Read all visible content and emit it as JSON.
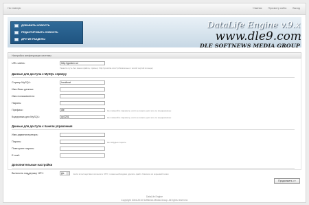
{
  "topbar": {
    "home_label": "На главную",
    "links": [
      "Главная",
      "Просмотр сайта",
      "Выход"
    ]
  },
  "header": {
    "menu": [
      {
        "label": "ДОБАВИТЬ НОВОСТЬ",
        "icon": "add-news-icon"
      },
      {
        "label": "РЕДАКТИРОВАТЬ НОВОСТЬ",
        "icon": "edit-news-icon"
      },
      {
        "label": "ДРУГИЕ РАЗДЕЛЫ",
        "icon": "sections-icon"
      }
    ],
    "logo_title": "DataLife Engine v.9.x",
    "logo_site": "www.dle9.com",
    "logo_group": "DLE SOFTNEWS MEDIA GROUP"
  },
  "panel": {
    "title": "Настройка конфигурации системы",
    "url_label": "URL сайта:",
    "url_value": "http://gordev.ru/",
    "url_hint": "Укажите путь без имени файла, пример: http://yoursite.com/ (обязательно с косой чертой в конце)",
    "db_section": "Данные для доступа к MySQL серверу",
    "db_fields": [
      {
        "label": "Сервер MySQL:",
        "value": "localhost",
        "hint": ""
      },
      {
        "label": "Имя базы данных:",
        "value": "",
        "hint": ""
      },
      {
        "label": "Имя пользователя:",
        "value": "",
        "hint": ""
      },
      {
        "label": "Пароль:",
        "value": "",
        "hint": ""
      },
      {
        "label": "Префикс:",
        "value": "dle",
        "hint": "Не изменяйте параметр, если не знаете для чего он предназначен"
      },
      {
        "label": "Кодировка для MySQL:",
        "value": "cp1251",
        "hint": "Не изменяйте параметр, если не знаете для чего он предназначен"
      }
    ],
    "admin_section": "Данные для доступа к панели управления",
    "admin_fields": [
      {
        "label": "Имя администратора:",
        "value": "",
        "hint": ""
      },
      {
        "label": "Пароль:",
        "value": "",
        "hint": "Не забудьте пароль"
      },
      {
        "label": "Повторите пароль:",
        "value": "",
        "hint": ""
      },
      {
        "label": "E-mail:",
        "value": "",
        "hint": ""
      }
    ],
    "extra_section": "Дополнительные настройки",
    "chpu_label": "Включить поддержку ЧПУ:",
    "chpu_value": "Да",
    "chpu_hint": "Если в последствии отключите ЧПУ, то вам необходимо удалить файл .htaccess из корневой папки",
    "continue_label": "Продолжить >>"
  },
  "footer": {
    "line1": "DataLife Engine",
    "line2": "Copyright 2004-2010 SoftNews Media Group. All rights reserved."
  }
}
